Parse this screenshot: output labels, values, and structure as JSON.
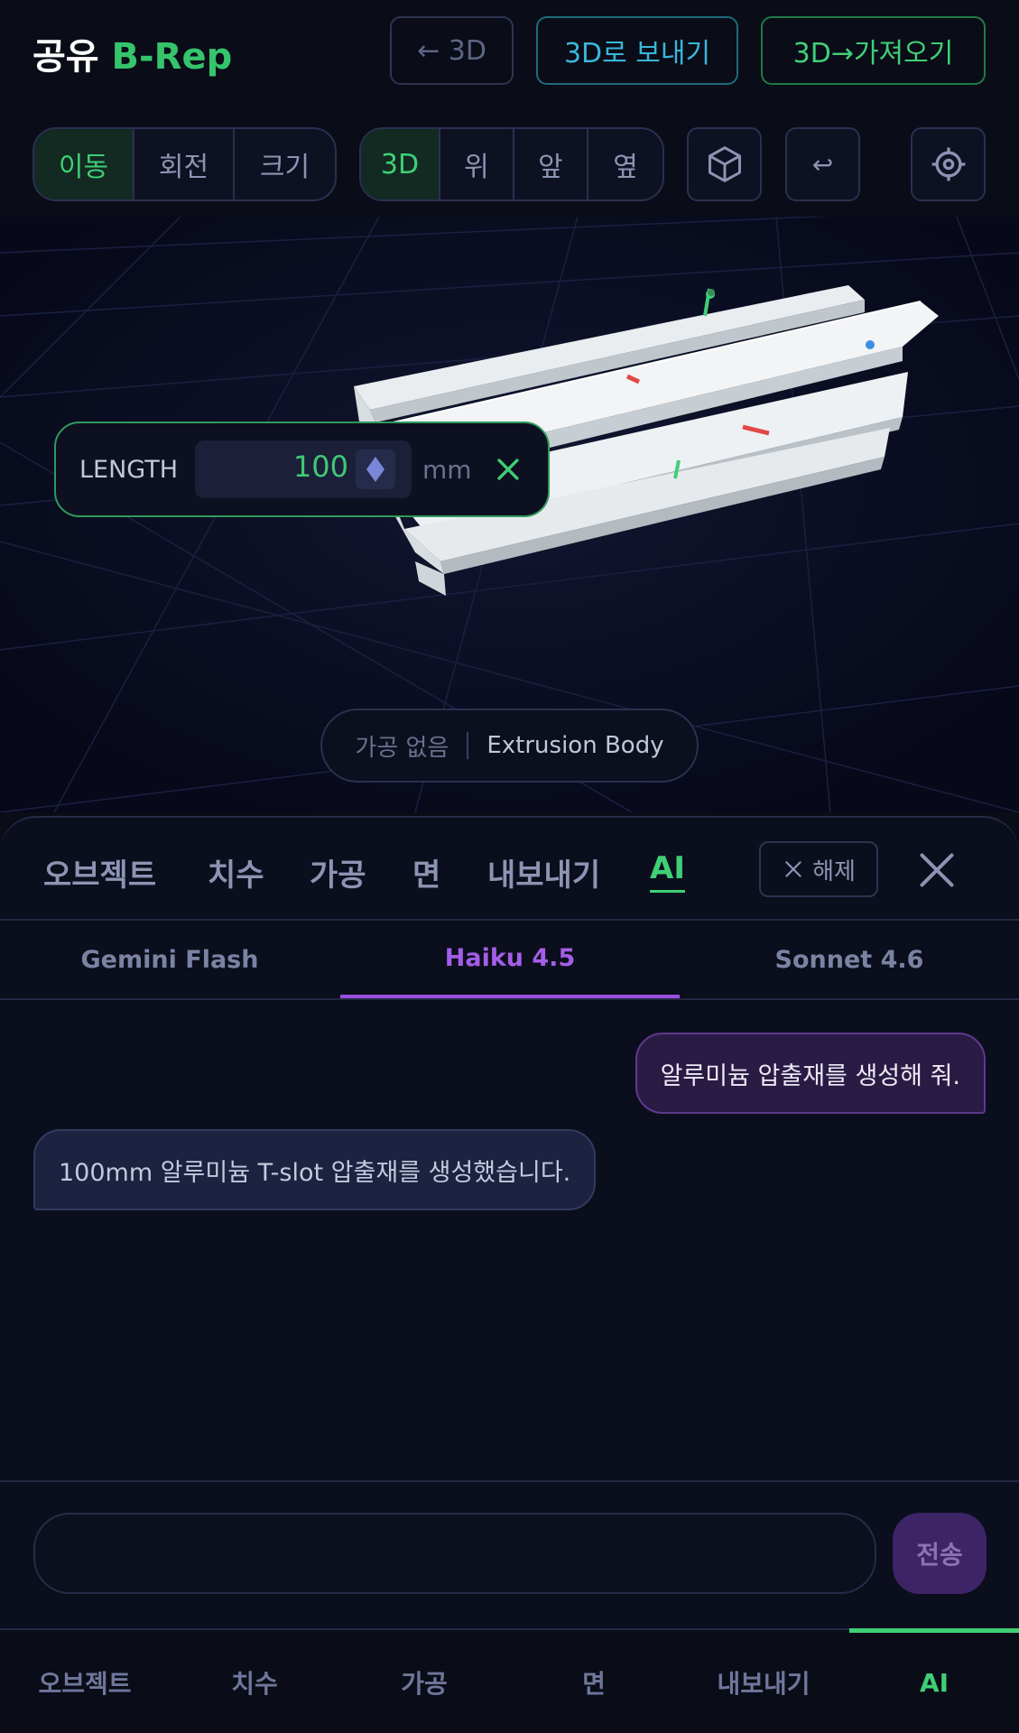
{
  "header": {
    "title_prefix": "공유",
    "title_accent": "B-Rep",
    "back_label": "← 3D",
    "send_label": "3D로 보내기",
    "import_label": "3D→가져오기"
  },
  "toolbar": {
    "transform_modes": [
      "이동",
      "회전",
      "크기"
    ],
    "active_transform": "이동",
    "view_modes": [
      "3D",
      "위",
      "앞",
      "옆"
    ],
    "active_view": "3D",
    "undo_glyph": "↩"
  },
  "param": {
    "label": "LENGTH",
    "value": "100",
    "unit": "mm"
  },
  "status": {
    "machining": "가공 없음",
    "body": "Extrusion Body"
  },
  "panel": {
    "tabs": [
      "오브젝트",
      "치수",
      "가공",
      "면",
      "내보내기",
      "AI"
    ],
    "active_tab": "AI",
    "release_label": "해제",
    "models": [
      "Gemini Flash",
      "Haiku 4.5",
      "Sonnet 4.6"
    ],
    "active_model": "Haiku 4.5",
    "messages": [
      {
        "role": "user",
        "text": "알루미늄 압출재를 생성해 줘."
      },
      {
        "role": "assistant",
        "text": "100mm 알루미늄 T-slot 압출재를 생성했습니다."
      }
    ],
    "input_value": "",
    "send_label": "전송"
  },
  "bottom_nav": {
    "items": [
      "오브젝트",
      "치수",
      "가공",
      "면",
      "내보내기",
      "AI"
    ],
    "active": "AI"
  },
  "colors": {
    "accent_green": "#3fcf76",
    "accent_purple": "#9b4fe0",
    "accent_cyan": "#39b6d8",
    "background": "#0a0c18"
  }
}
